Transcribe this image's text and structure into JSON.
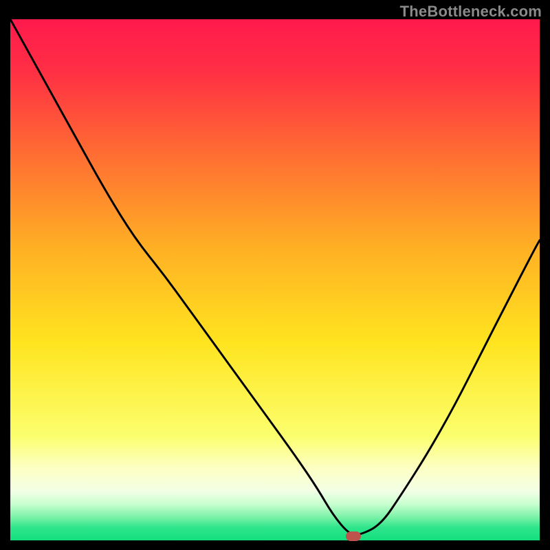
{
  "watermark": "TheBottleneck.com",
  "marker": {
    "x_frac": 0.648,
    "y_frac": 0.992
  },
  "chart_data": {
    "type": "line",
    "title": "",
    "xlabel": "",
    "ylabel": "",
    "xlim": [
      0,
      1
    ],
    "ylim": [
      0,
      1
    ],
    "grid": false,
    "legend": false,
    "annotations": [
      "TheBottleneck.com"
    ],
    "background_gradient_stops": [
      {
        "pos": 0.0,
        "color": "#ff1a4d"
      },
      {
        "pos": 0.1,
        "color": "#ff2f44"
      },
      {
        "pos": 0.25,
        "color": "#ff6a33"
      },
      {
        "pos": 0.44,
        "color": "#ffb024"
      },
      {
        "pos": 0.62,
        "color": "#ffe41f"
      },
      {
        "pos": 0.8,
        "color": "#fbff6e"
      },
      {
        "pos": 0.86,
        "color": "#fdffc2"
      },
      {
        "pos": 0.905,
        "color": "#f3ffe6"
      },
      {
        "pos": 0.93,
        "color": "#c9ffd0"
      },
      {
        "pos": 0.955,
        "color": "#7df2a8"
      },
      {
        "pos": 0.975,
        "color": "#2fe58c"
      },
      {
        "pos": 1.0,
        "color": "#13df7d"
      }
    ],
    "series": [
      {
        "name": "bottleneck-curve",
        "x": [
          0.0,
          0.06,
          0.12,
          0.18,
          0.235,
          0.29,
          0.34,
          0.39,
          0.44,
          0.49,
          0.54,
          0.58,
          0.61,
          0.64,
          0.66,
          0.7,
          0.74,
          0.79,
          0.84,
          0.89,
          0.94,
          0.99,
          1.0
        ],
        "y": [
          1.0,
          0.89,
          0.78,
          0.67,
          0.58,
          0.51,
          0.44,
          0.37,
          0.3,
          0.23,
          0.16,
          0.1,
          0.048,
          0.012,
          0.01,
          0.03,
          0.09,
          0.17,
          0.26,
          0.36,
          0.46,
          0.558,
          0.576
        ]
      }
    ],
    "marker": {
      "x": 0.648,
      "y": 0.01,
      "color": "#bd534c",
      "shape": "rounded-rect"
    }
  }
}
